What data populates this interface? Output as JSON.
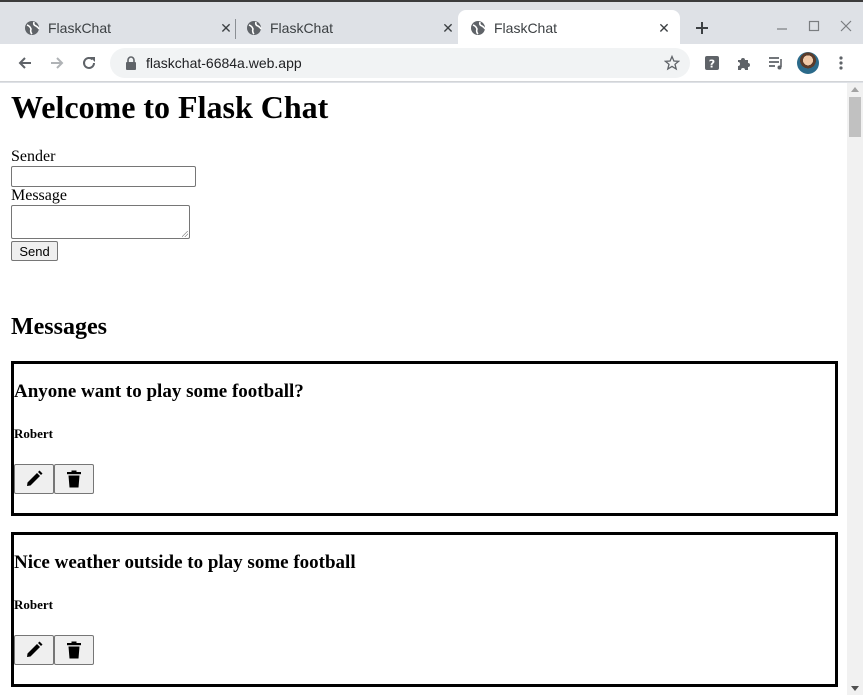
{
  "browser": {
    "tabs": [
      {
        "title": "FlaskChat",
        "active": false
      },
      {
        "title": "FlaskChat",
        "active": false
      },
      {
        "title": "FlaskChat",
        "active": true
      }
    ],
    "url": "flaskchat-6684a.web.app"
  },
  "page": {
    "heading": "Welcome to Flask Chat",
    "form": {
      "sender_label": "Sender",
      "sender_value": "",
      "message_label": "Message",
      "message_value": "",
      "send_label": "Send"
    },
    "messages_heading": "Messages",
    "messages": [
      {
        "text": "Anyone want to play some football?",
        "sender": "Robert"
      },
      {
        "text": "Nice weather outside to play some football",
        "sender": "Robert"
      }
    ]
  },
  "icons": {
    "tab": "globe-icon",
    "edit": "pencil-icon",
    "delete": "trash-icon"
  },
  "colors": {
    "tabstrip": "#dee1e6",
    "omnibox": "#f1f3f4",
    "card_border": "#000000"
  }
}
